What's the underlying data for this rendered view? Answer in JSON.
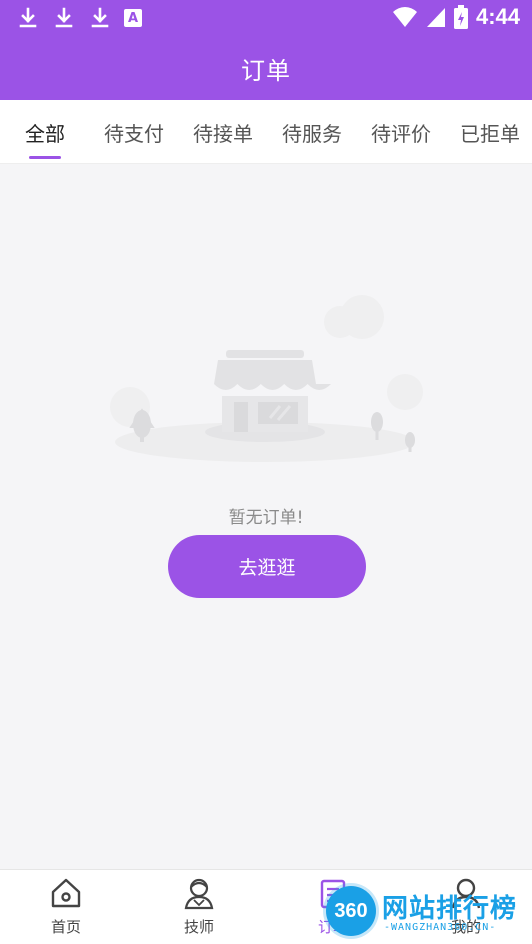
{
  "status_bar": {
    "time": "4:44",
    "left_icons": [
      "download-icon",
      "download-icon",
      "download-icon",
      "a-icon"
    ],
    "right_icons": [
      "wifi-icon",
      "signal-icon",
      "battery-charging-icon"
    ]
  },
  "header": {
    "title": "订单"
  },
  "tabs": [
    {
      "label": "全部",
      "active": true
    },
    {
      "label": "待支付",
      "active": false
    },
    {
      "label": "待接单",
      "active": false
    },
    {
      "label": "待服务",
      "active": false
    },
    {
      "label": "待评价",
      "active": false
    },
    {
      "label": "已拒单",
      "active": false
    }
  ],
  "empty_state": {
    "icon": "empty-store-icon",
    "message": "暂无订单!",
    "button_label": "去逛逛"
  },
  "bottom_nav": [
    {
      "label": "首页",
      "icon": "home-icon",
      "active": false
    },
    {
      "label": "技师",
      "icon": "technician-icon",
      "active": false
    },
    {
      "label": "订单",
      "icon": "order-icon",
      "active": true
    },
    {
      "label": "我的",
      "icon": "profile-icon",
      "active": false
    }
  ],
  "watermark": {
    "logo_text": "360",
    "title": "网站排行榜",
    "subtitle": "-WANGZHAN360.CN-"
  },
  "colors": {
    "primary": "#9b53e6",
    "background": "#f5f5f7",
    "watermark": "#1aa0e6"
  }
}
